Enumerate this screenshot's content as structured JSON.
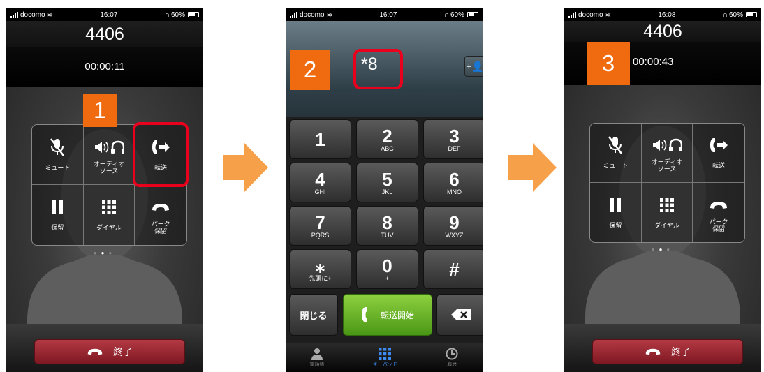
{
  "status_bars": [
    {
      "carrier": "docomo",
      "time": "16:07",
      "battery": "60%"
    },
    {
      "carrier": "docomo",
      "time": "16:07",
      "battery": "60%"
    },
    {
      "carrier": "docomo",
      "time": "16:08",
      "battery": "60%"
    }
  ],
  "screen1": {
    "number": "4406",
    "timer": "00:00:11",
    "step": "1",
    "buttons": [
      {
        "icon": "mic-mute-icon",
        "label": "ミュート"
      },
      {
        "icon": "audio-source-icon",
        "label": "オーディオ\nソース"
      },
      {
        "icon": "transfer-icon",
        "label": "転送"
      },
      {
        "icon": "hold-icon",
        "label": "保留"
      },
      {
        "icon": "dialpad-icon",
        "label": "ダイヤル"
      },
      {
        "icon": "park-hold-icon",
        "label": "パーク\n保留"
      }
    ],
    "end_label": "終了"
  },
  "screen2": {
    "step": "2",
    "dial_text": "*8",
    "keys": [
      {
        "digit": "1",
        "sub": ""
      },
      {
        "digit": "2",
        "sub": "ABC"
      },
      {
        "digit": "3",
        "sub": "DEF"
      },
      {
        "digit": "4",
        "sub": "GHI"
      },
      {
        "digit": "5",
        "sub": "JKL"
      },
      {
        "digit": "6",
        "sub": "MNO"
      },
      {
        "digit": "7",
        "sub": "PQRS"
      },
      {
        "digit": "8",
        "sub": "TUV"
      },
      {
        "digit": "9",
        "sub": "WXYZ"
      },
      {
        "digit": "⁎",
        "sub": "先頭に+"
      },
      {
        "digit": "0",
        "sub": "+"
      },
      {
        "digit": "#",
        "sub": ""
      }
    ],
    "close_label": "閉じる",
    "transfer_start_label": "転送開始",
    "tabs": [
      {
        "icon": "contacts-icon",
        "label": "電話帳"
      },
      {
        "icon": "keypad-icon",
        "label": "キーパッド"
      },
      {
        "icon": "recents-icon",
        "label": "履歴"
      }
    ]
  },
  "screen3": {
    "number": "4406",
    "timer": "00:00:43",
    "step": "3",
    "buttons": [
      {
        "icon": "mic-mute-icon",
        "label": "ミュート"
      },
      {
        "icon": "audio-source-icon",
        "label": "オーディオ\nソース"
      },
      {
        "icon": "transfer-icon",
        "label": "転送"
      },
      {
        "icon": "hold-icon",
        "label": "保留"
      },
      {
        "icon": "dialpad-icon",
        "label": "ダイヤル"
      },
      {
        "icon": "park-hold-icon",
        "label": "パーク\n保留"
      }
    ],
    "end_label": "終了"
  },
  "colors": {
    "badge": "#f06a10",
    "highlight": "#e8001c",
    "arrow": "#f7a04a",
    "end_button": "#9b2530",
    "transfer_button": "#6ab22a"
  }
}
